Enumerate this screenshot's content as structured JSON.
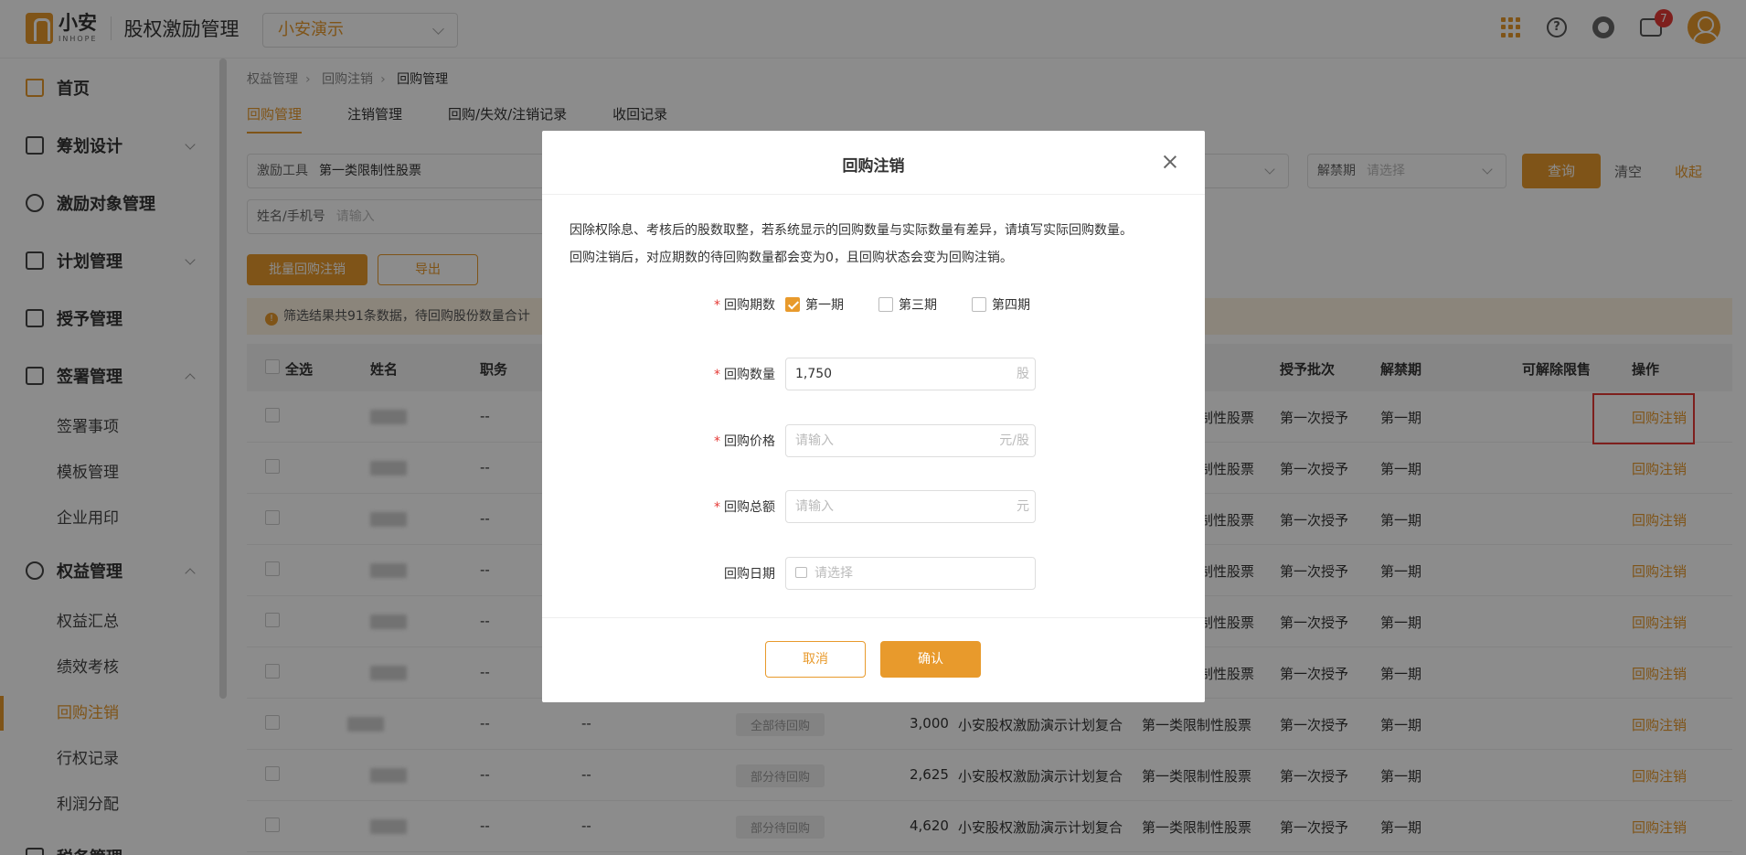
{
  "header": {
    "logo_cn": "小安",
    "logo_en": "INHOPE",
    "app_title": "股权激励管理",
    "org": "小安演示",
    "notification_count": "7"
  },
  "sidebar": {
    "items": [
      {
        "label": "首页"
      },
      {
        "label": "筹划设计"
      },
      {
        "label": "激励对象管理"
      },
      {
        "label": "计划管理"
      },
      {
        "label": "授予管理"
      },
      {
        "label": "签署管理"
      },
      {
        "label": "签署事项"
      },
      {
        "label": "模板管理"
      },
      {
        "label": "企业用印"
      },
      {
        "label": "权益管理"
      },
      {
        "label": "权益汇总"
      },
      {
        "label": "绩效考核"
      },
      {
        "label": "回购注销"
      },
      {
        "label": "行权记录"
      },
      {
        "label": "利润分配"
      },
      {
        "label": "税务管理"
      }
    ]
  },
  "breadcrumb": [
    "权益管理",
    "回购注销",
    "回购管理"
  ],
  "tabs": [
    "回购管理",
    "注销管理",
    "回购/失效/注销记录",
    "收回记录"
  ],
  "filters": {
    "tool_label": "激励工具",
    "tool_value": "第一类限制性股票",
    "name_label": "姓名/手机号",
    "name_placeholder": "请输入",
    "unlock_label": "解禁期",
    "unlock_placeholder": "请选择",
    "query": "查询",
    "clear": "清空",
    "collapse": "收起"
  },
  "actions": {
    "batch": "批量回购注销",
    "export": "导出"
  },
  "notice": "筛选结果共91条数据，待回购股份数量合计",
  "table": {
    "headers": {
      "select_all": "全选",
      "name": "姓名",
      "position": "职务",
      "batch": "授予批次",
      "unlock": "解禁期",
      "releasable": "可解除限售",
      "op": "操作"
    },
    "rows": [
      {
        "position": "--",
        "tool": "限制性股票",
        "batch": "第一次授予",
        "unlock": "第一期",
        "op": "回购注销"
      },
      {
        "position": "--",
        "tool": "限制性股票",
        "batch": "第一次授予",
        "unlock": "第一期",
        "op": "回购注销"
      },
      {
        "position": "--",
        "tool": "限制性股票",
        "batch": "第一次授予",
        "unlock": "第一期",
        "op": "回购注销"
      },
      {
        "position": "--",
        "tool": "限制性股票",
        "batch": "第一次授予",
        "unlock": "第一期",
        "op": "回购注销"
      },
      {
        "position": "--",
        "tool": "限制性股票",
        "batch": "第一次授予",
        "unlock": "第一期",
        "op": "回购注销"
      },
      {
        "position": "--",
        "tool": "限制性股票",
        "batch": "第一次授予",
        "unlock": "第一期",
        "op": "回购注销"
      },
      {
        "position": "--",
        "dept": "--",
        "status": "全部待回购",
        "qty": "3,000",
        "plan": "小安股权激励演示计划复合",
        "tool": "第一类限制性股票",
        "batch": "第一次授予",
        "unlock": "第一期",
        "op": "回购注销"
      },
      {
        "position": "--",
        "dept": "--",
        "status": "部分待回购",
        "qty": "2,625",
        "plan": "小安股权激励演示计划复合",
        "tool": "第一类限制性股票",
        "batch": "第一次授予",
        "unlock": "第一期",
        "op": "回购注销"
      },
      {
        "position": "--",
        "dept": "--",
        "status": "部分待回购",
        "qty": "4,620",
        "plan": "小安股权激励演示计划复合",
        "tool": "第一类限制性股票",
        "batch": "第一次授予",
        "unlock": "第一期",
        "op": "回购注销"
      }
    ]
  },
  "modal": {
    "title": "回购注销",
    "desc_line1": "因除权除息、考核后的股数取整，若系统显示的回购数量与实际数量有差异，请填写实际回购数量。",
    "desc_line2": "回购注销后，对应期数的待回购数量都会变为0，且回购状态会变为回购注销。",
    "period_label": "回购期数",
    "periods": [
      {
        "label": "第一期",
        "checked": true
      },
      {
        "label": "第三期",
        "checked": false
      },
      {
        "label": "第四期",
        "checked": false
      }
    ],
    "qty_label": "回购数量",
    "qty_value": "1,750",
    "qty_unit": "股",
    "price_label": "回购价格",
    "price_placeholder": "请输入",
    "price_unit": "元/股",
    "total_label": "回购总额",
    "total_placeholder": "请输入",
    "total_unit": "元",
    "date_label": "回购日期",
    "date_placeholder": "请选择",
    "cancel": "取消",
    "confirm": "确认"
  },
  "colors": {
    "accent": "#e89a2c",
    "danger": "#e53935"
  }
}
